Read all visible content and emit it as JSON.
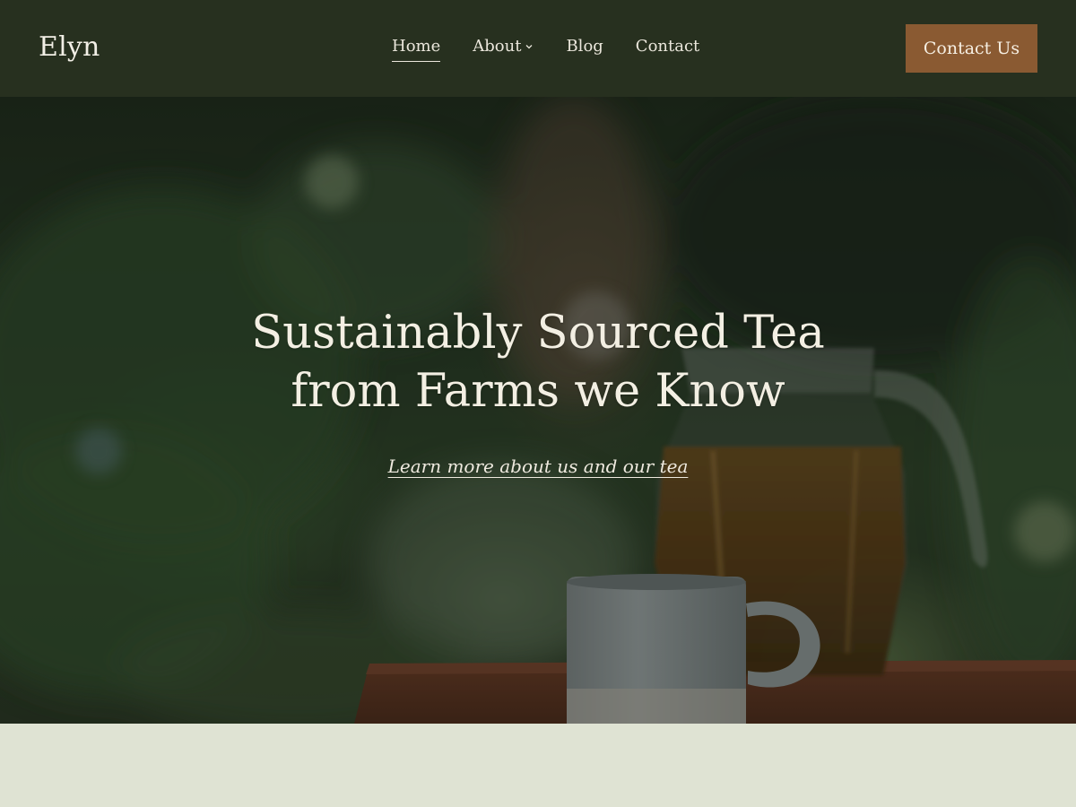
{
  "header": {
    "brand": "Elyn",
    "nav": [
      {
        "label": "Home",
        "active": true
      },
      {
        "label": "About",
        "has_dropdown": true,
        "icon": "chevron-down-icon"
      },
      {
        "label": "Blog"
      },
      {
        "label": "Contact"
      }
    ],
    "cta_label": "Contact Us"
  },
  "hero": {
    "title": "Sustainably Sourced Tea\nfrom Farms we Know",
    "link_label": "Learn more about us and our tea",
    "image": "tea-pitcher-and-mug"
  },
  "colors": {
    "header_bg": "#27301f",
    "cta_bg": "#8a5a32",
    "hero_text": "#f3efe3",
    "section_bg": "#dfe3d3"
  }
}
